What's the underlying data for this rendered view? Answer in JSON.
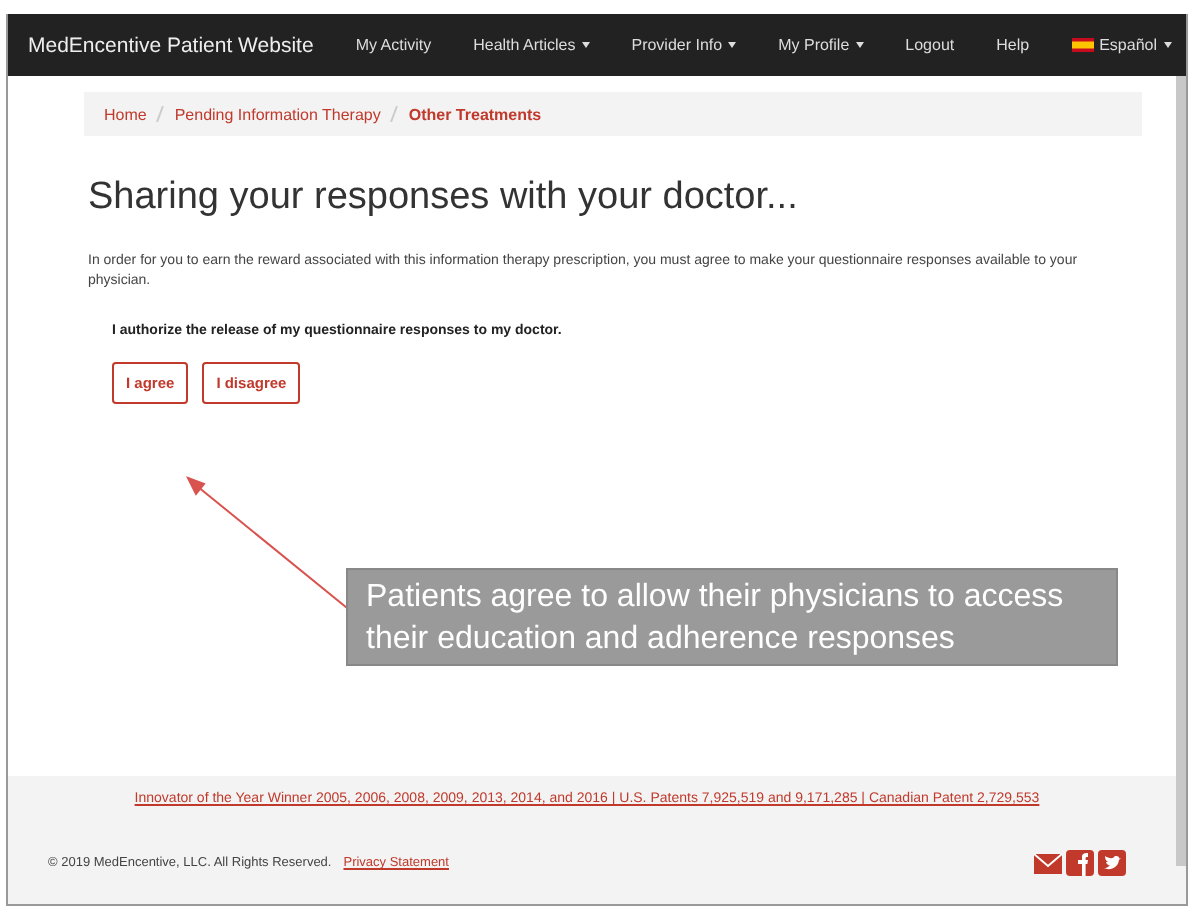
{
  "navbar": {
    "brand": "MedEncentive Patient Website",
    "items": [
      {
        "label": "My Activity",
        "dropdown": false
      },
      {
        "label": "Health Articles",
        "dropdown": true
      },
      {
        "label": "Provider Info",
        "dropdown": true
      },
      {
        "label": "My Profile",
        "dropdown": true
      },
      {
        "label": "Logout",
        "dropdown": false
      },
      {
        "label": "Help",
        "dropdown": false
      },
      {
        "label": "Español",
        "dropdown": true,
        "kind": "language"
      }
    ]
  },
  "breadcrumb": [
    {
      "label": "Home",
      "selected": false
    },
    {
      "label": "Pending Information Therapy",
      "selected": false
    },
    {
      "label": "Other Treatments",
      "selected": true
    }
  ],
  "heading": "Sharing your responses with your doctor...",
  "intro": "In order for you to earn the reward associated with this information therapy prescription, you must agree to make your questionnaire responses available to your physician.",
  "authorization": "I authorize the release of my questionnaire responses to my doctor.",
  "buttons": [
    "I agree",
    "I disagree"
  ],
  "callout": "Patients agree to allow their physicians to access their education and adherence responses",
  "footer": {
    "awards": "Innovator of the Year Winner 2005, 2006, 2008, 2009, 2013, 2014, and 2016 | U.S. Patents 7,925,519 and 9,171,285 | Canadian Patent 2,729,553",
    "copyright": "© 2019 MedEncentive, LLC. All Rights Reserved.",
    "privacy": "Privacy Statement"
  }
}
